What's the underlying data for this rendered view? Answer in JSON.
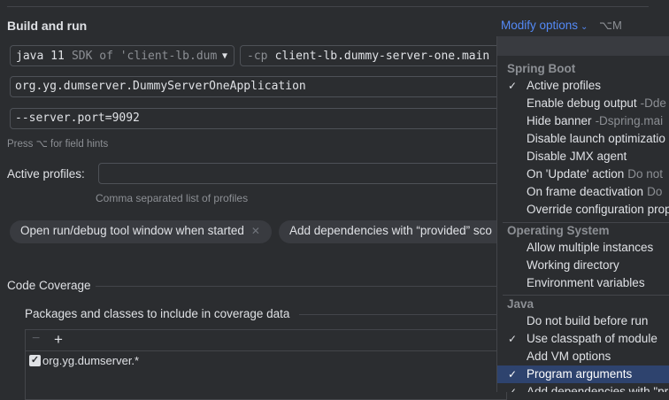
{
  "header": {
    "title": "Build and run",
    "modify_options": "Modify options",
    "shortcut": "⌥M"
  },
  "jdk": {
    "value": "java 11",
    "hint": "SDK of 'client-lb.dum"
  },
  "classpath": {
    "flag": "-cp",
    "value": "client-lb.dummy-server-one.main"
  },
  "main_class": "org.yg.dumserver.DummyServerOneApplication",
  "program_args": "--server.port=9092",
  "field_hints": "Press ⌥ for field hints",
  "active_profiles": {
    "label": "Active profiles:",
    "value": "",
    "hint": "Comma separated list of profiles"
  },
  "chips": [
    {
      "label": "Open run/debug tool window when started"
    },
    {
      "label": "Add dependencies with “provided” sco"
    }
  ],
  "coverage": {
    "title": "Code Coverage",
    "packages_label": "Packages and classes to include in coverage data",
    "entries": [
      {
        "label": "org.yg.dumserver.*",
        "checked": true
      }
    ]
  },
  "menu": {
    "groups": [
      {
        "title": "Spring Boot",
        "items": [
          {
            "label": "Active profiles",
            "checked": true,
            "hint": ""
          },
          {
            "label": "Enable debug output",
            "checked": false,
            "hint": "-Dde"
          },
          {
            "label": "Hide banner",
            "checked": false,
            "hint": "-Dspring.mai"
          },
          {
            "label": "Disable launch optimizatio",
            "checked": false,
            "hint": ""
          },
          {
            "label": "Disable JMX agent",
            "checked": false,
            "hint": ""
          },
          {
            "label": "On 'Update' action",
            "checked": false,
            "hint": "Do not"
          },
          {
            "label": "On frame deactivation",
            "checked": false,
            "hint": "Do"
          },
          {
            "label": "Override configuration prop",
            "checked": false,
            "hint": ""
          }
        ]
      },
      {
        "title": "Operating System",
        "items": [
          {
            "label": "Allow multiple instances",
            "checked": false,
            "hint": ""
          },
          {
            "label": "Working directory",
            "checked": false,
            "hint": ""
          },
          {
            "label": "Environment variables",
            "checked": false,
            "hint": ""
          }
        ]
      },
      {
        "title": "Java",
        "items": [
          {
            "label": "Do not build before run",
            "checked": false,
            "hint": ""
          },
          {
            "label": "Use classpath of module",
            "checked": true,
            "hint": ""
          },
          {
            "label": "Add VM options",
            "checked": false,
            "hint": ""
          },
          {
            "label": "Program arguments",
            "checked": true,
            "hint": "",
            "selected": true
          },
          {
            "label": "Add dependencies with \"pr",
            "checked": true,
            "hint": ""
          }
        ]
      }
    ]
  },
  "colors": {
    "accent": "#548af7",
    "selection": "#2e436e",
    "background": "#2b2d30"
  }
}
